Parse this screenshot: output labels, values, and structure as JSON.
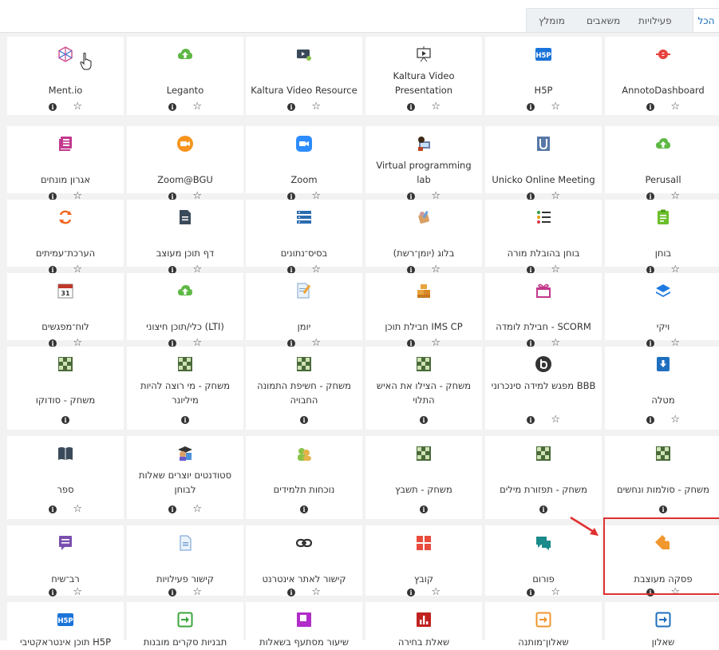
{
  "tabs": {
    "all": "הכל",
    "activities": "פעילויות",
    "resources": "משאבים",
    "recommended": "מומלץ"
  },
  "colors": {
    "accent": "#0f6cbf",
    "highlight": "#e03030"
  },
  "tiles": [
    {
      "label": "AnnotoDashboard",
      "icon": "annoto-icon",
      "star": true
    },
    {
      "label": "H5P",
      "icon": "h5p-icon",
      "star": true
    },
    {
      "label": "Kaltura Video Presentation",
      "icon": "kaltura-presentation-icon",
      "star": true
    },
    {
      "label": "Kaltura Video Resource",
      "icon": "kaltura-resource-icon",
      "star": true
    },
    {
      "label": "Leganto",
      "icon": "lti-icon",
      "star": true
    },
    {
      "label": "Ment.io",
      "icon": "mentio-icon",
      "star": true
    },
    {
      "label": "Perusall",
      "icon": "lti-icon",
      "star": true
    },
    {
      "label": "Unicko Online Meeting",
      "icon": "unicko-icon",
      "star": true
    },
    {
      "label": "Virtual programming lab",
      "icon": "vpl-icon",
      "star": true
    },
    {
      "label": "Zoom",
      "icon": "zoom-icon",
      "star": true
    },
    {
      "label": "Zoom@BGU",
      "icon": "zoom-bgu-icon",
      "star": true
    },
    {
      "label": "אגרון מונחים",
      "icon": "glossary-icon",
      "star": true
    },
    {
      "label": "בוחן",
      "icon": "quiz-icon",
      "star": true
    },
    {
      "label": "בוחן בהובלת מורה",
      "icon": "teacher-quiz-icon",
      "star": true
    },
    {
      "label": "בלוג (יומן־רשת)",
      "icon": "blog-icon",
      "star": true
    },
    {
      "label": "בסיס־נתונים",
      "icon": "database-icon",
      "star": true
    },
    {
      "label": "דף תוכן מעוצב",
      "icon": "page-icon",
      "star": true
    },
    {
      "label": "הערכת־עמיתים",
      "icon": "workshop-icon",
      "star": true
    },
    {
      "label": "ויקי",
      "icon": "wiki-icon",
      "star": true
    },
    {
      "label": "חבילת לומדה - SCORM",
      "icon": "scorm-icon",
      "star": true
    },
    {
      "label": "חבילת תוכן IMS CP",
      "icon": "imscp-icon",
      "star": true
    },
    {
      "label": "יומן",
      "icon": "journal-icon",
      "star": true
    },
    {
      "label": "כלי/תוכן חיצוני (LTI)",
      "icon": "lti-icon",
      "star": true
    },
    {
      "label": "לוח־מפגשים",
      "icon": "calendar-icon",
      "star": true
    },
    {
      "label": "מטלה",
      "icon": "assignment-icon",
      "star": true
    },
    {
      "label": "מפגש למידה סינכרוני BBB",
      "icon": "bbb-icon",
      "star": true
    },
    {
      "label": "משחק - הצילו את האיש התלוי",
      "icon": "game-icon",
      "star": false
    },
    {
      "label": "משחק - חשיפת התמונה החבויה",
      "icon": "game-icon",
      "star": false
    },
    {
      "label": "משחק - מי רוצה להיות מיליונר",
      "icon": "game-icon",
      "star": false
    },
    {
      "label": "משחק - סודוקו",
      "icon": "game-icon",
      "star": false
    },
    {
      "label": "משחק - סולמות ונחשים",
      "icon": "game-icon",
      "star": false
    },
    {
      "label": "משחק - תפזורת מילים",
      "icon": "game-icon",
      "star": false
    },
    {
      "label": "משחק - תשבץ",
      "icon": "game-icon",
      "star": false
    },
    {
      "label": "נוכחות תלמידים",
      "icon": "attendance-icon",
      "star": false
    },
    {
      "label": "סטודנטים יוצרים שאלות לבוחן",
      "icon": "student-quiz-icon",
      "star": true
    },
    {
      "label": "ספר",
      "icon": "book-icon",
      "star": true
    },
    {
      "label": "פסקה מעוצבת",
      "icon": "label-icon",
      "star": true
    },
    {
      "label": "פורום",
      "icon": "forum-icon",
      "star": true
    },
    {
      "label": "קובץ",
      "icon": "file-icon",
      "star": true
    },
    {
      "label": "קישור לאתר אינטרנט",
      "icon": "url-icon",
      "star": true
    },
    {
      "label": "קישור פעילויות",
      "icon": "activity-link-icon",
      "star": true
    },
    {
      "label": "רב־שיח",
      "icon": "chat-icon",
      "star": true
    },
    {
      "label": "שאלון",
      "icon": "questionnaire-icon",
      "star": false
    },
    {
      "label": "שאלון־מותנה",
      "icon": "conditional-questionnaire-icon",
      "star": false
    },
    {
      "label": "שאלת בחירה",
      "icon": "choice-icon",
      "star": false
    },
    {
      "label": "שיעור מסתעף בשאלות",
      "icon": "lesson-icon",
      "star": false
    },
    {
      "label": "תבניות סקרים מובנות",
      "icon": "survey-icon",
      "star": false
    },
    {
      "label": "תוכן אינטראקטיבי H5P",
      "icon": "h5p-icon",
      "star": false
    }
  ]
}
